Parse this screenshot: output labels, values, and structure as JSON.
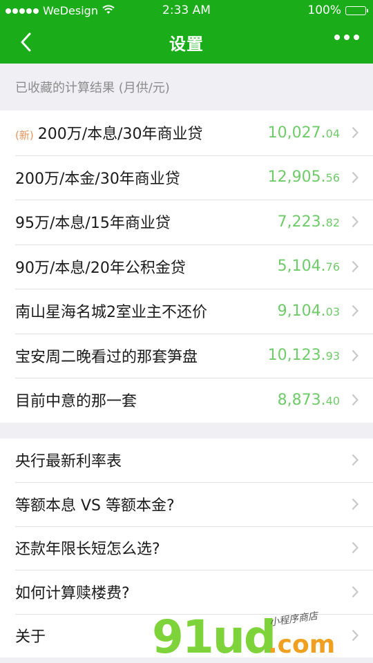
{
  "status_bar": {
    "carrier": "WeDesign",
    "time": "2:33 AM",
    "battery": "100%",
    "battery_level": 1.0
  },
  "nav": {
    "title": "设置",
    "back_icon": "chevron-left-icon",
    "more_icon": "more-dots-icon"
  },
  "saved_section": {
    "header": "已收藏的计算结果 (月供/元)",
    "items": [
      {
        "tag": "(新)",
        "label": "200万/本息/30年商业贷",
        "amount_int": "10,027.",
        "amount_dec": "04"
      },
      {
        "tag": "",
        "label": "200万/本金/30年商业贷",
        "amount_int": "12,905.",
        "amount_dec": "56"
      },
      {
        "tag": "",
        "label": "95万/本息/15年商业贷",
        "amount_int": "7,223.",
        "amount_dec": "82"
      },
      {
        "tag": "",
        "label": "90万/本息/20年公积金贷",
        "amount_int": "5,104.",
        "amount_dec": "76"
      },
      {
        "tag": "",
        "label": "南山星海名城2室业主不还价",
        "amount_int": "9,104.",
        "amount_dec": "03"
      },
      {
        "tag": "",
        "label": "宝安周二晚看过的那套笋盘",
        "amount_int": "10,123.",
        "amount_dec": "93"
      },
      {
        "tag": "",
        "label": "目前中意的那一套",
        "amount_int": "8,873.",
        "amount_dec": "40"
      }
    ]
  },
  "info_section": {
    "items": [
      {
        "label": "央行最新利率表"
      },
      {
        "label": "等额本息 VS 等额本金?"
      },
      {
        "label": "还款年限长短怎么选?"
      },
      {
        "label": "如何计算赎楼费?"
      },
      {
        "label": "关于"
      }
    ]
  },
  "watermark": {
    "big": "91ud",
    "com": ".com",
    "small": "小程序商店"
  },
  "colors": {
    "brand_green": "#1aad19",
    "amount_green": "#6ecb68",
    "new_tag_orange": "#e8945a",
    "background": "#efeff4"
  }
}
